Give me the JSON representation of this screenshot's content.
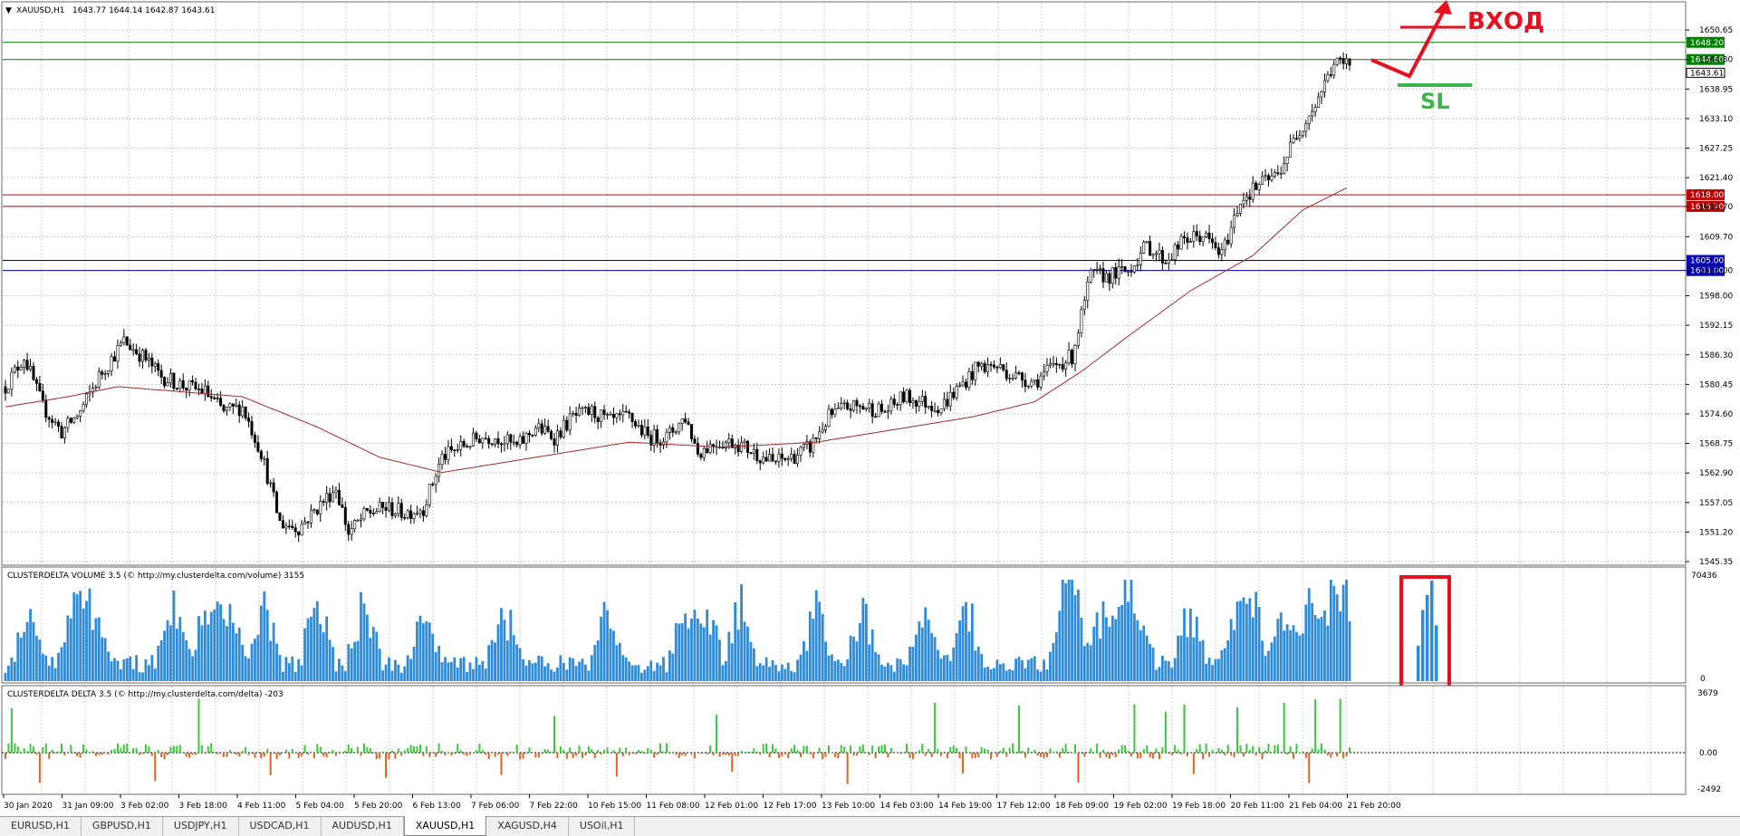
{
  "window": {
    "symbol_header": "XAUUSD,H1",
    "ohlc": "1643.77 1644.14 1642.87 1643.61"
  },
  "price_axis": {
    "ticks": [
      "1650.65",
      "1644.80",
      "1638.95",
      "1633.10",
      "1627.25",
      "1621.40",
      "1615.70",
      "1609.70",
      "1603.00",
      "1598.00",
      "1592.15",
      "1586.30",
      "1580.45",
      "1574.60",
      "1568.75",
      "1562.90",
      "1557.05",
      "1551.20",
      "1545.35"
    ],
    "current": "1643.61"
  },
  "levels": [
    {
      "price": 1648.2,
      "label": "1648.20",
      "color": "#008000"
    },
    {
      "price": 1644.8,
      "label": "1644.80",
      "color": "#008000"
    },
    {
      "price": 1618.0,
      "label": "1618.00",
      "color": "#c00000"
    },
    {
      "price": 1615.7,
      "label": "1615.70",
      "color": "#c00000"
    },
    {
      "price": 1605.0,
      "label": "1605.00",
      "color": "#0000b0"
    },
    {
      "price": 1603.0,
      "label": "1603.00",
      "color": "#0000b0"
    }
  ],
  "annotations": {
    "entry_label": "ВХОД",
    "sl_label": "SL",
    "entry_color": "#e8101f",
    "sl_color": "#39b54a"
  },
  "volume_panel": {
    "title": "CLUSTERDELTA VOLUME 3.5 (© http://my.clusterdelta.com/volume) 3155",
    "max_label": "70436",
    "zero_label": "0",
    "bar_color": "#2e8bd8"
  },
  "delta_panel": {
    "title": "CLUSTERDELTA DELTA 3.5 (© http://my.clusterdelta.com/delta) -203",
    "max_label": "3679",
    "zero_label": "0.00",
    "min_label": "-2492",
    "pos_color": "#3cc63c",
    "neg_color": "#e0641e"
  },
  "time_axis": [
    "30 Jan 2020",
    "31 Jan 09:00",
    "3 Feb 02:00",
    "3 Feb 18:00",
    "4 Feb 11:00",
    "5 Feb 04:00",
    "5 Feb 20:00",
    "6 Feb 13:00",
    "7 Feb 06:00",
    "7 Feb 22:00",
    "10 Feb 15:00",
    "11 Feb 08:00",
    "12 Feb 01:00",
    "12 Feb 17:00",
    "13 Feb 10:00",
    "14 Feb 03:00",
    "14 Feb 19:00",
    "17 Feb 12:00",
    "18 Feb 09:00",
    "19 Feb 02:00",
    "19 Feb 18:00",
    "20 Feb 11:00",
    "21 Feb 04:00",
    "21 Feb 20:00"
  ],
  "tabs": [
    {
      "label": "EURUSD,H1",
      "active": false
    },
    {
      "label": "GBPUSD,H1",
      "active": false
    },
    {
      "label": "USDJPY,H1",
      "active": false
    },
    {
      "label": "USDCAD,H1",
      "active": false
    },
    {
      "label": "AUDUSD,H1",
      "active": false
    },
    {
      "label": "XAUUSD,H1",
      "active": true
    },
    {
      "label": "XAGUSD,H4",
      "active": false
    },
    {
      "label": "USOil,H1",
      "active": false
    }
  ],
  "chart_data": {
    "type": "candlestick",
    "symbol": "XAUUSD",
    "timeframe": "H1",
    "ylim": [
      1545.35,
      1653.0
    ],
    "close_path": [
      [
        0,
        1580
      ],
      [
        6,
        1586
      ],
      [
        12,
        1576
      ],
      [
        18,
        1571
      ],
      [
        24,
        1575
      ],
      [
        30,
        1582
      ],
      [
        38,
        1589
      ],
      [
        44,
        1586
      ],
      [
        50,
        1582
      ],
      [
        58,
        1580
      ],
      [
        64,
        1579
      ],
      [
        70,
        1575
      ],
      [
        76,
        1576
      ],
      [
        82,
        1567
      ],
      [
        88,
        1553
      ],
      [
        94,
        1552
      ],
      [
        100,
        1556
      ],
      [
        106,
        1560
      ],
      [
        110,
        1551
      ],
      [
        116,
        1555
      ],
      [
        122,
        1556
      ],
      [
        128,
        1555
      ],
      [
        134,
        1556
      ],
      [
        140,
        1566
      ],
      [
        146,
        1568
      ],
      [
        152,
        1570
      ],
      [
        158,
        1570
      ],
      [
        164,
        1568
      ],
      [
        170,
        1572
      ],
      [
        176,
        1570
      ],
      [
        182,
        1574
      ],
      [
        188,
        1575
      ],
      [
        194,
        1573
      ],
      [
        200,
        1574
      ],
      [
        206,
        1570
      ],
      [
        212,
        1570
      ],
      [
        218,
        1574
      ],
      [
        222,
        1567
      ],
      [
        228,
        1569
      ],
      [
        234,
        1569
      ],
      [
        240,
        1567
      ],
      [
        246,
        1565
      ],
      [
        252,
        1566
      ],
      [
        258,
        1568
      ],
      [
        264,
        1574
      ],
      [
        270,
        1576
      ],
      [
        276,
        1576
      ],
      [
        282,
        1575
      ],
      [
        288,
        1578
      ],
      [
        294,
        1577
      ],
      [
        300,
        1576
      ],
      [
        306,
        1580
      ],
      [
        312,
        1584
      ],
      [
        318,
        1584
      ],
      [
        324,
        1582
      ],
      [
        330,
        1581
      ],
      [
        336,
        1584
      ],
      [
        342,
        1586
      ],
      [
        348,
        1602
      ],
      [
        354,
        1602
      ],
      [
        360,
        1603
      ],
      [
        366,
        1608
      ],
      [
        372,
        1605
      ],
      [
        378,
        1609
      ],
      [
        384,
        1610
      ],
      [
        390,
        1606
      ],
      [
        396,
        1617
      ],
      [
        402,
        1620
      ],
      [
        408,
        1622
      ],
      [
        414,
        1630
      ],
      [
        420,
        1636
      ],
      [
        426,
        1644
      ],
      [
        432,
        1644
      ]
    ],
    "ma_path": [
      [
        0,
        1576
      ],
      [
        20,
        1578
      ],
      [
        36,
        1580
      ],
      [
        56,
        1579
      ],
      [
        76,
        1578
      ],
      [
        100,
        1572
      ],
      [
        120,
        1566
      ],
      [
        140,
        1563
      ],
      [
        170,
        1566
      ],
      [
        200,
        1569
      ],
      [
        230,
        1568
      ],
      [
        260,
        1569
      ],
      [
        280,
        1571
      ],
      [
        310,
        1574
      ],
      [
        330,
        1577
      ],
      [
        345,
        1583
      ],
      [
        360,
        1590
      ],
      [
        380,
        1599
      ],
      [
        400,
        1606
      ],
      [
        416,
        1615
      ],
      [
        432,
        1620
      ]
    ],
    "n_bars": 432,
    "volume_max": 70436,
    "delta_range": [
      -2492,
      3679
    ]
  }
}
